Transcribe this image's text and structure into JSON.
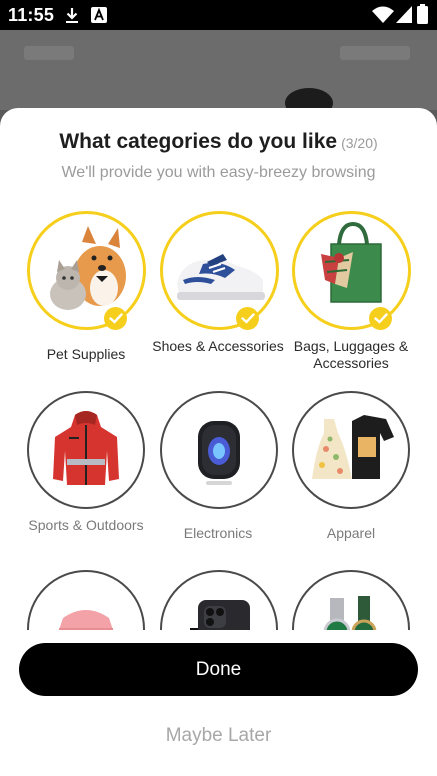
{
  "status_bar": {
    "time": "11:55",
    "icons": [
      "download-icon",
      "font-icon",
      "wifi-icon",
      "signal-icon",
      "battery-icon"
    ]
  },
  "dialog": {
    "title": "What categories do you like",
    "counter": "(3/20)",
    "subtitle": "We'll provide you with easy-breezy browsing",
    "categories": [
      {
        "label": "Pet Supplies",
        "selected": true
      },
      {
        "label": "Shoes & Accessories",
        "selected": true
      },
      {
        "label": "Bags, Luggages & Accessories",
        "selected": true
      },
      {
        "label": "Sports & Outdoors",
        "selected": false
      },
      {
        "label": "Electronics",
        "selected": false
      },
      {
        "label": "Apparel",
        "selected": false
      },
      {
        "label": "",
        "selected": false
      },
      {
        "label": "",
        "selected": false
      },
      {
        "label": "",
        "selected": false
      }
    ],
    "done_label": "Done",
    "later_label": "Maybe Later"
  },
  "colors": {
    "accent": "#f6cf1d",
    "button": "#000000"
  }
}
